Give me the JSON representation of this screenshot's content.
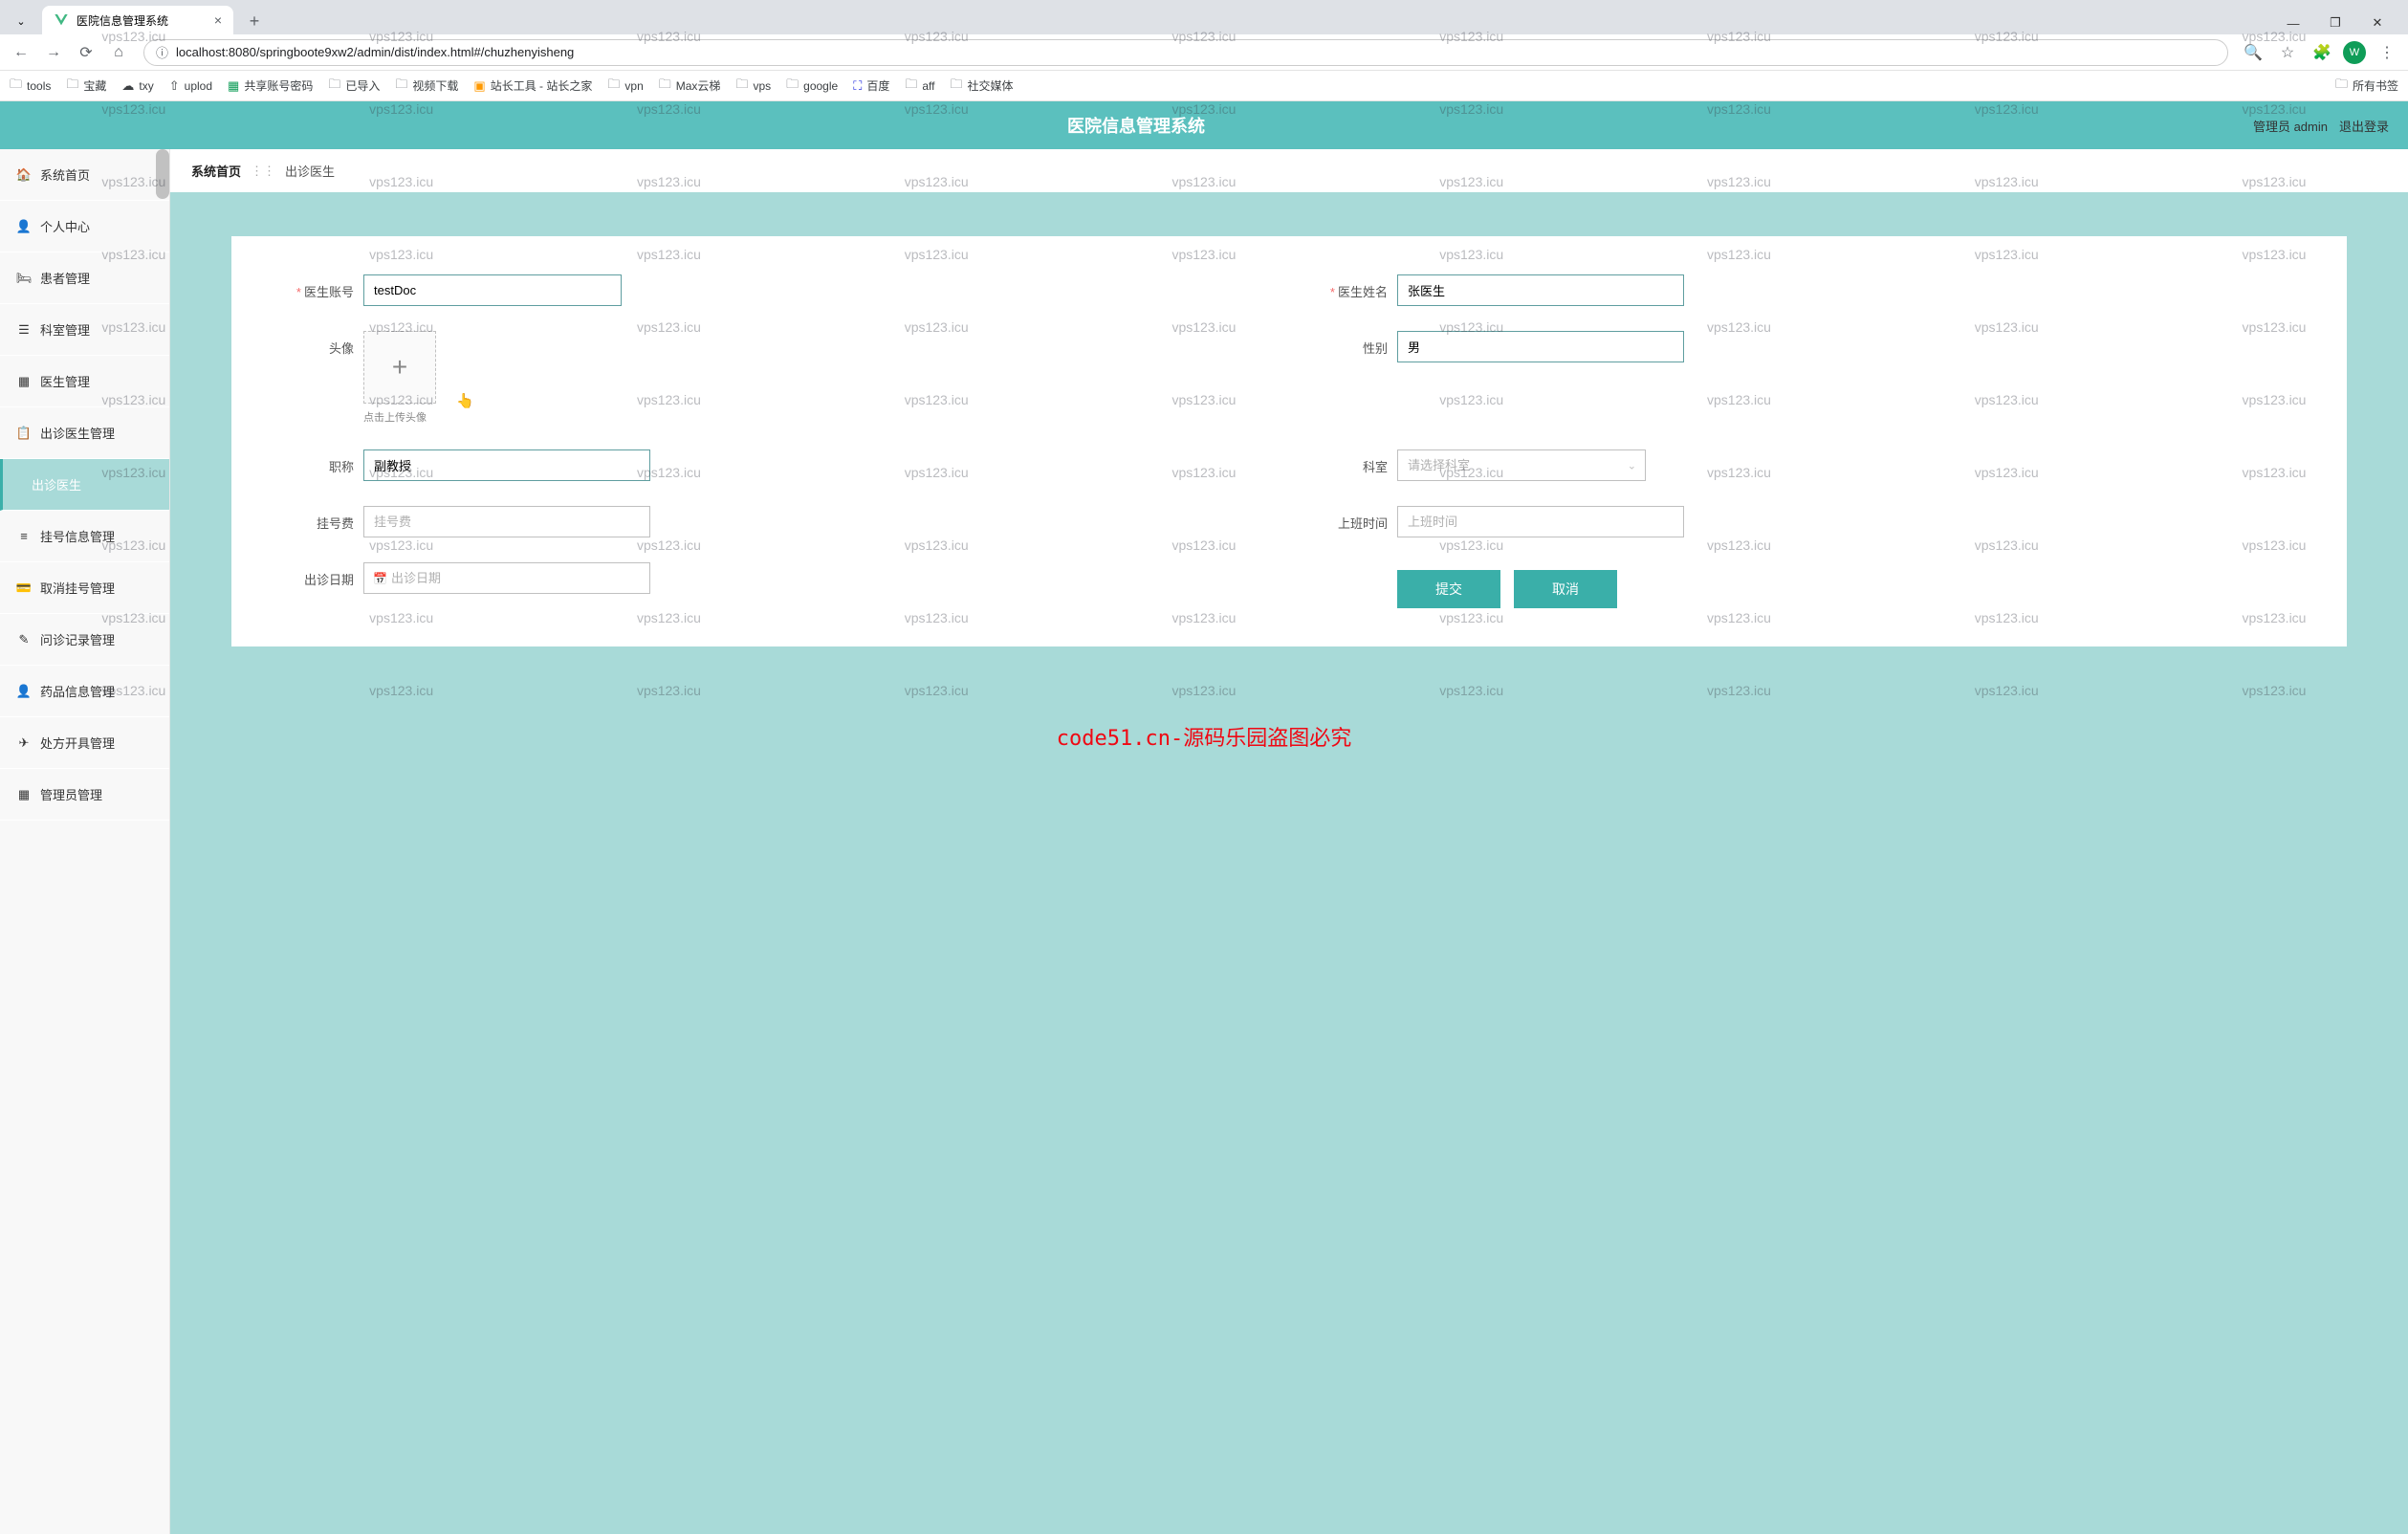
{
  "browser": {
    "tab_title": "医院信息管理系统",
    "url": "localhost:8080/springboote9xw2/admin/dist/index.html#/chuzhenyisheng",
    "avatar_letter": "W",
    "all_bookmarks": "所有书签"
  },
  "bookmarks": [
    {
      "icon": "folder",
      "label": "tools"
    },
    {
      "icon": "folder",
      "label": "宝藏"
    },
    {
      "icon": "cloud",
      "label": "txy"
    },
    {
      "icon": "up",
      "label": "uplod"
    },
    {
      "icon": "sheet",
      "label": "共享账号密码"
    },
    {
      "icon": "folder",
      "label": "已导入"
    },
    {
      "icon": "folder",
      "label": "视频下载"
    },
    {
      "icon": "tool",
      "label": "站长工具 - 站长之家"
    },
    {
      "icon": "folder",
      "label": "vpn"
    },
    {
      "icon": "folder",
      "label": "Max云梯"
    },
    {
      "icon": "folder",
      "label": "vps"
    },
    {
      "icon": "folder",
      "label": "google"
    },
    {
      "icon": "baidu",
      "label": "百度"
    },
    {
      "icon": "folder",
      "label": "aff"
    },
    {
      "icon": "folder",
      "label": "社交媒体"
    }
  ],
  "app": {
    "title": "医院信息管理系统",
    "user_label": "管理员 admin",
    "logout": "退出登录"
  },
  "sidebar": {
    "items": [
      {
        "icon": "🏠",
        "label": "系统首页"
      },
      {
        "icon": "👤",
        "label": "个人中心"
      },
      {
        "icon": "🛏",
        "label": "患者管理"
      },
      {
        "icon": "☰",
        "label": "科室管理"
      },
      {
        "icon": "▦",
        "label": "医生管理"
      },
      {
        "icon": "📋",
        "label": "出诊医生管理"
      },
      {
        "icon": "",
        "label": "出诊医生",
        "sub": true
      },
      {
        "icon": "≡",
        "label": "挂号信息管理"
      },
      {
        "icon": "💳",
        "label": "取消挂号管理"
      },
      {
        "icon": "✎",
        "label": "问诊记录管理"
      },
      {
        "icon": "👤",
        "label": "药品信息管理"
      },
      {
        "icon": "✈",
        "label": "处方开具管理"
      },
      {
        "icon": "▦",
        "label": "管理员管理"
      }
    ]
  },
  "breadcrumb": {
    "home": "系统首页",
    "current": "出诊医生"
  },
  "form": {
    "doctor_account_label": "医生账号",
    "doctor_account_value": "testDoc",
    "doctor_name_label": "医生姓名",
    "doctor_name_value": "张医生",
    "avatar_label": "头像",
    "upload_hint": "点击上传头像",
    "gender_label": "性别",
    "gender_value": "男",
    "title_label": "职称",
    "title_value": "副教授",
    "dept_label": "科室",
    "dept_placeholder": "请选择科室",
    "fee_label": "挂号费",
    "fee_placeholder": "挂号费",
    "worktime_label": "上班时间",
    "worktime_placeholder": "上班时间",
    "visit_date_label": "出诊日期",
    "visit_date_placeholder": "出诊日期",
    "submit": "提交",
    "cancel": "取消"
  },
  "watermark": {
    "text": "vps123.icu",
    "center": "code51.cn-源码乐园盗图必究"
  }
}
